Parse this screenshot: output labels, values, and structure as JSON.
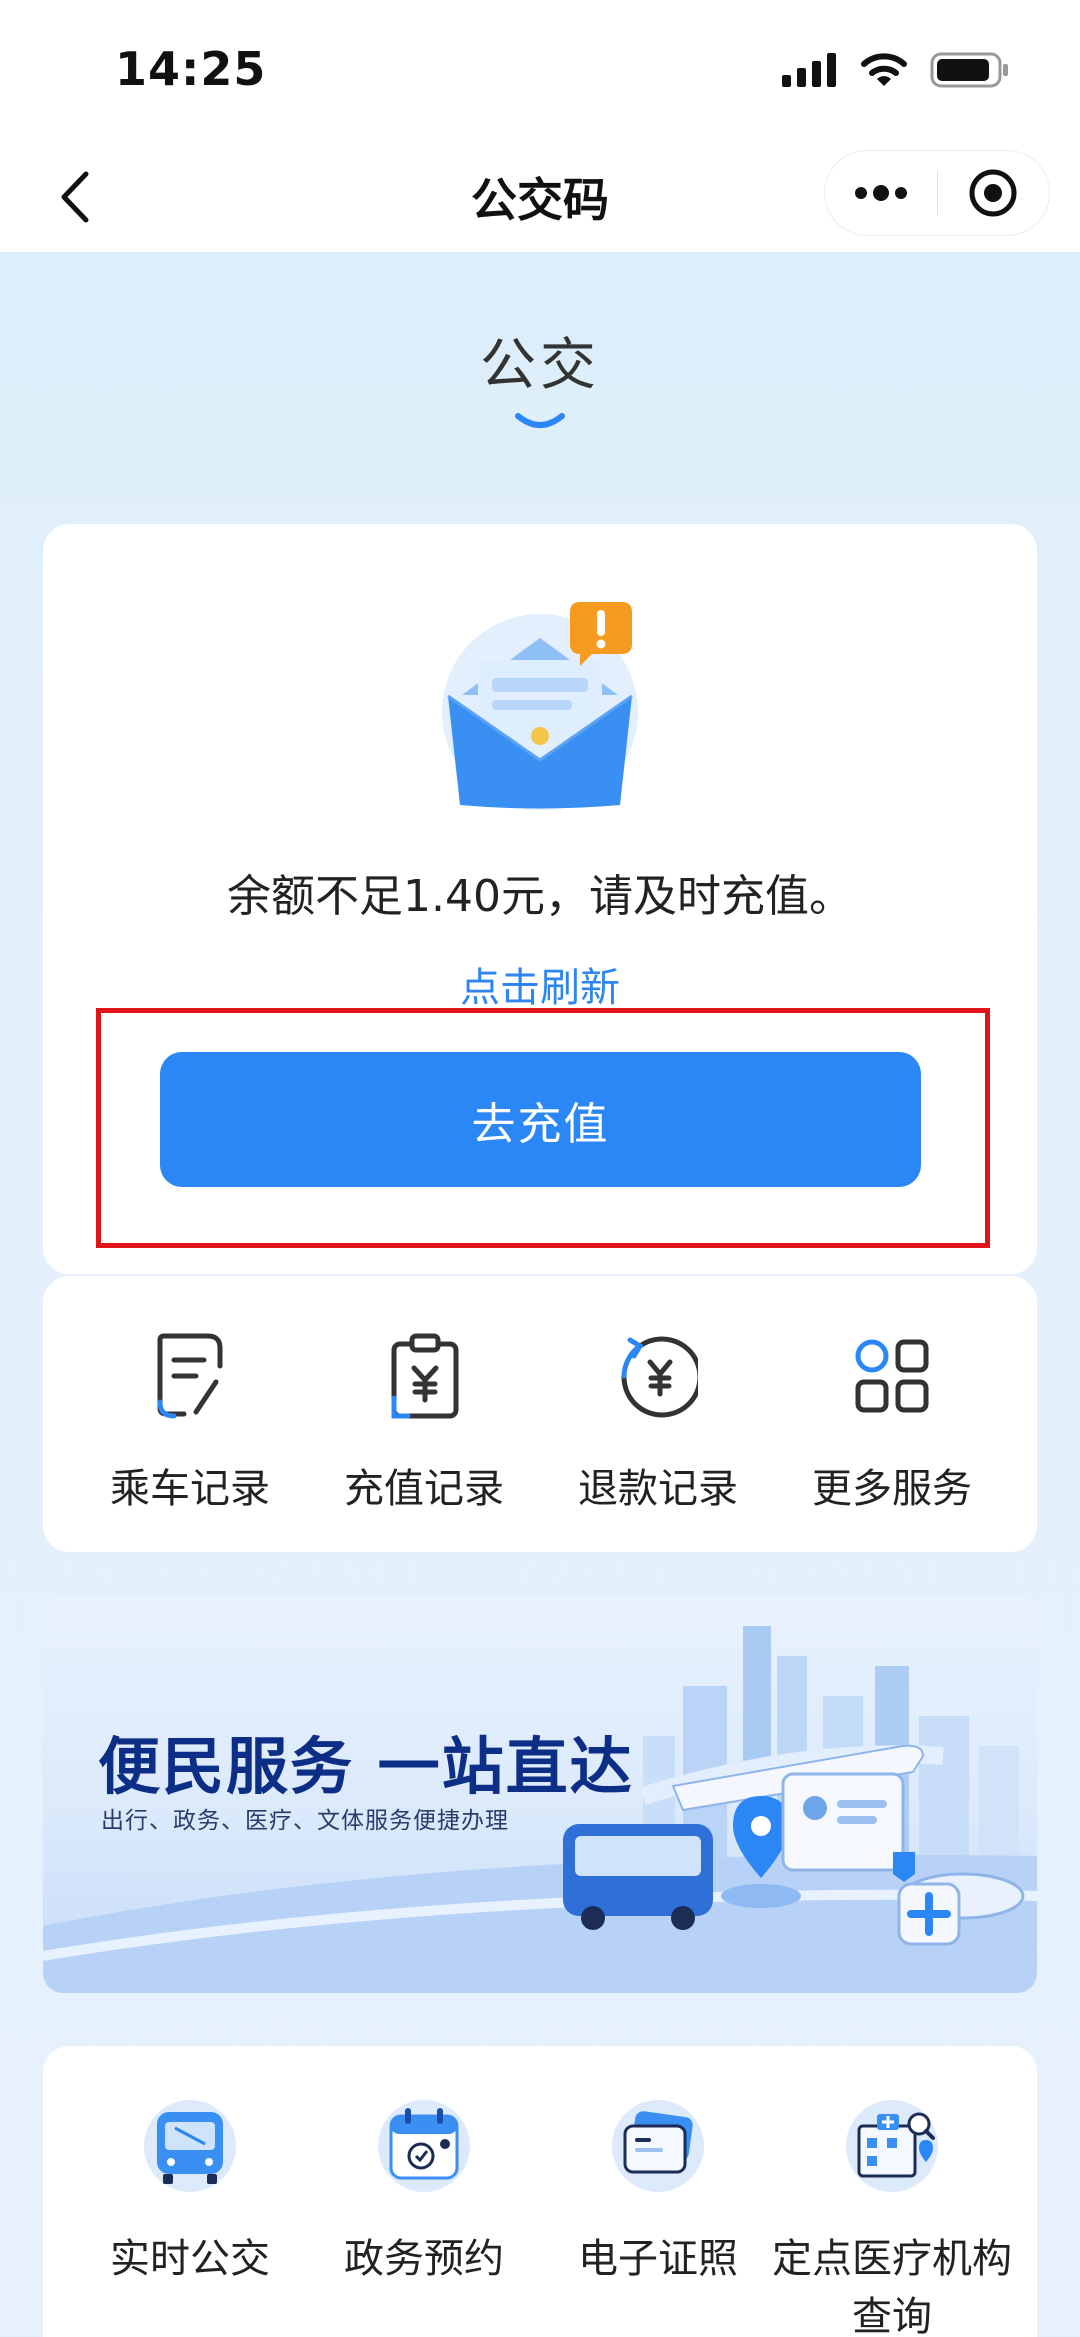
{
  "status_bar": {
    "time": "14:25"
  },
  "nav": {
    "title": "公交码"
  },
  "tab": {
    "title": "公交"
  },
  "card": {
    "message": "余额不足1.40元，请及时充值。",
    "refresh_link": "点击刷新",
    "recharge_button": "去充值"
  },
  "services": [
    {
      "label": "乘车记录",
      "icon": "ride-record-icon"
    },
    {
      "label": "充值记录",
      "icon": "recharge-record-icon"
    },
    {
      "label": "退款记录",
      "icon": "refund-record-icon"
    },
    {
      "label": "更多服务",
      "icon": "more-services-icon"
    }
  ],
  "banner": {
    "title": "便民服务 一站直达",
    "subtitle": "出行、政务、医疗、文体服务便捷办理"
  },
  "bottom_services": [
    {
      "label": "实时公交",
      "icon": "realtime-bus-icon"
    },
    {
      "label": "政务预约",
      "icon": "gov-appointment-icon"
    },
    {
      "label": "电子证照",
      "icon": "e-license-icon"
    },
    {
      "label": "定点医疗机构查询",
      "icon": "medical-institution-icon"
    }
  ],
  "colors": {
    "accent": "#2b87f5",
    "highlight": "#e0151b",
    "banner_title": "#0d2e86"
  }
}
